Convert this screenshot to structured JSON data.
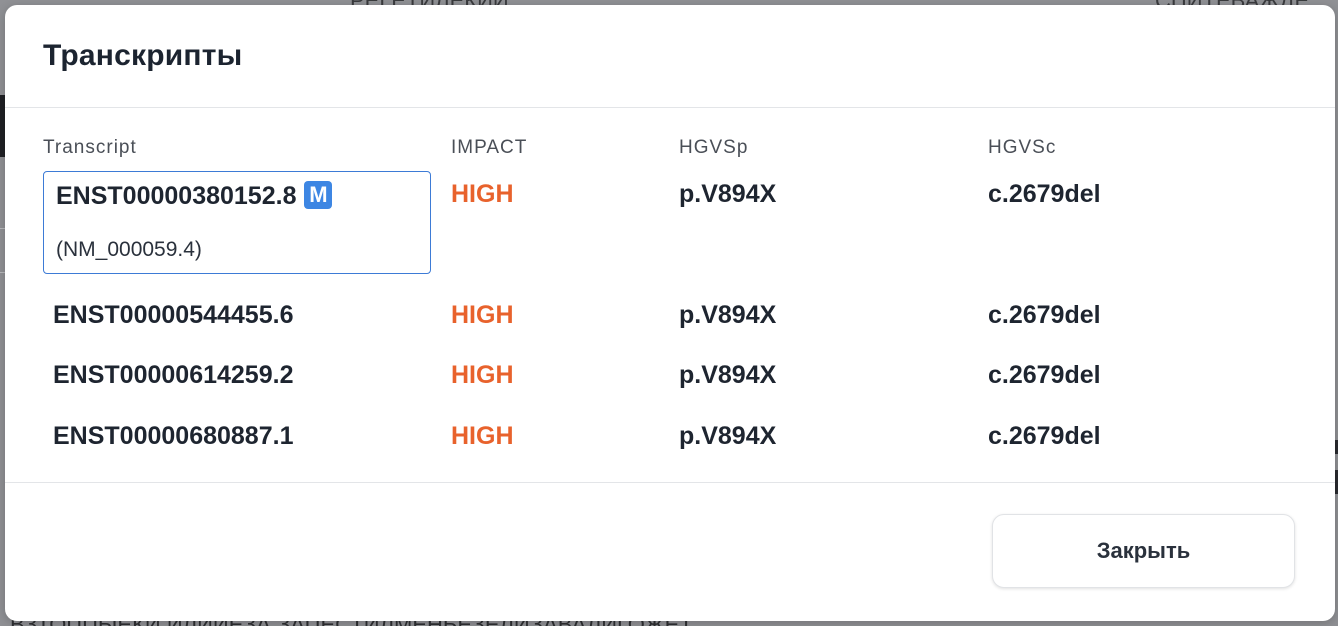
{
  "background": {
    "top_left_text": "РЕГЕТИЛЕКИЙ",
    "top_right_text": "СПИТЕВАЖДЕ",
    "bottom_text": "ВЗТОППЫЕКИ ИЛИЙЕЗА ЗАПЕСТИЛМЕНЬЕЗЕЛИЗАВАЛИГОЖЕТ"
  },
  "modal": {
    "title": "Транскрипты",
    "columns": {
      "transcript": "Transcript",
      "impact": "IMPACT",
      "hgvsp": "HGVSp",
      "hgvsc": "HGVSc"
    },
    "rows": [
      {
        "transcript": "ENST00000380152.8",
        "badge": "M",
        "alt_id": "(NM_000059.4)",
        "impact": "HIGH",
        "hgvsp": "p.V894X",
        "hgvsc": "c.2679del"
      },
      {
        "transcript": "ENST00000544455.6",
        "impact": "HIGH",
        "hgvsp": "p.V894X",
        "hgvsc": "c.2679del"
      },
      {
        "transcript": "ENST00000614259.2",
        "impact": "HIGH",
        "hgvsp": "p.V894X",
        "hgvsc": "c.2679del"
      },
      {
        "transcript": "ENST00000680887.1",
        "impact": "HIGH",
        "hgvsp": "p.V894X",
        "hgvsc": "c.2679del"
      }
    ],
    "close_label": "Закрыть"
  },
  "colors": {
    "impact_high": "#e8622c",
    "selected_border": "#3d7bd6",
    "badge_bg": "#3d86e3"
  }
}
